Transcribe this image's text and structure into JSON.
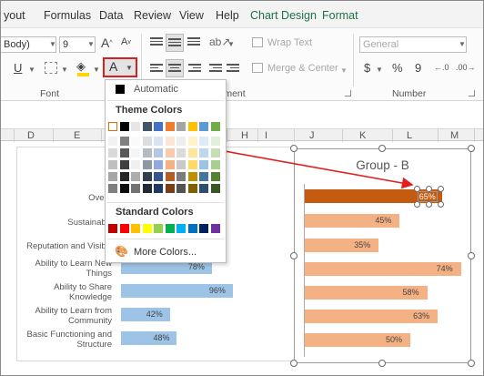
{
  "menubar": {
    "tabs": [
      "yout",
      "Formulas",
      "Data",
      "Review",
      "View",
      "Help",
      "Chart Design",
      "Format"
    ]
  },
  "ribbon": {
    "font_name": "Body)",
    "font_size": "9",
    "grow_glyph": "A",
    "shrink_glyph": "A",
    "underline_glyph": "U",
    "font_color_glyph": "A",
    "wrap_text_label": "Wrap Text",
    "merge_center_label": "Merge & Center",
    "number_format": "General",
    "currency_glyph": "$",
    "percent_glyph": "%",
    "comma_glyph": "9",
    "font_group_label": "Font",
    "alignment_group_label": "Alignment",
    "number_group_label": "Number"
  },
  "columns": [
    "D",
    "E",
    "F",
    "G",
    "H",
    "I",
    "J",
    "K",
    "L",
    "M"
  ],
  "dropdown": {
    "automatic_label": "Automatic",
    "theme_colors_label": "Theme Colors",
    "standard_colors_label": "Standard Colors",
    "more_colors_label": "More Colors...",
    "theme_top": [
      "#ffffff",
      "#000000",
      "#e7e6e6",
      "#44546a",
      "#4472c4",
      "#ed7d31",
      "#a5a5a5",
      "#ffc000",
      "#5b9bd5",
      "#70ad47"
    ],
    "standard": [
      "#c00000",
      "#ff0000",
      "#ffc000",
      "#ffff00",
      "#92d050",
      "#00b050",
      "#00b0f0",
      "#0070c0",
      "#002060",
      "#7030a0"
    ]
  },
  "left_chart": {
    "categories": [
      "Overa",
      "Sustainabili",
      "Reputation and Visibili",
      "Ability to Learn New Things",
      "Ability to Share Knowledge",
      "Ability to Learn from Community",
      "Basic Functioning and Structure"
    ],
    "value_labels": [
      "78%",
      "96%",
      "42%",
      "48%"
    ],
    "values": [
      0.78,
      0.96,
      0.42,
      0.48
    ],
    "bar_color": "#9dc3e6"
  },
  "right_chart": {
    "title": "Group - B",
    "value_labels": [
      "65%",
      "45%",
      "35%",
      "74%",
      "58%",
      "63%",
      "50%"
    ],
    "values": [
      0.65,
      0.45,
      0.35,
      0.74,
      0.58,
      0.63,
      0.5
    ],
    "bar_color": "#f4b183",
    "selected_color": "#c55a11",
    "arrow_color": "#e02020"
  }
}
